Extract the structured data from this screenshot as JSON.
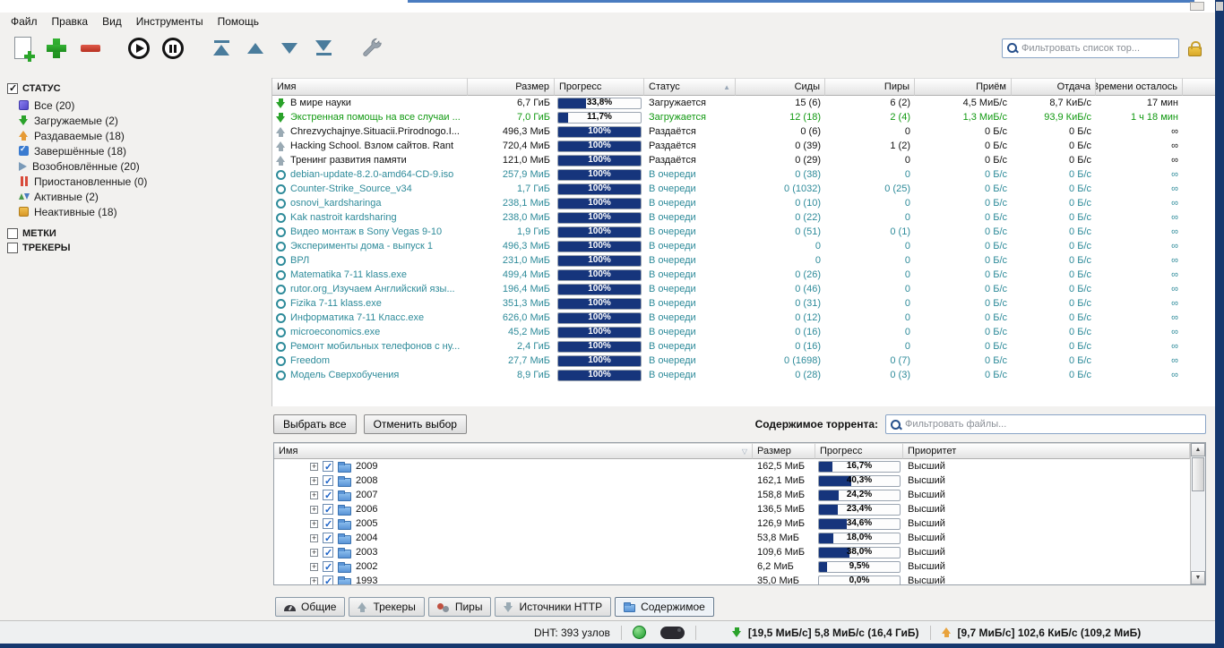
{
  "menu": {
    "items": [
      "Файл",
      "Правка",
      "Вид",
      "Инструменты",
      "Помощь"
    ]
  },
  "toolbar": {
    "filter_placeholder": "Фильтровать список тор...",
    "buttons": [
      "add-torrent",
      "add-link",
      "delete",
      "resume",
      "pause",
      "top-priority",
      "increase-priority",
      "decrease-priority",
      "bottom-priority",
      "options"
    ]
  },
  "icons": {
    "search-icon": "magnifier",
    "lock-icon": "gold padlock",
    "add-torrent-icon": "document with green plus",
    "add-link-icon": "green plus",
    "delete-icon": "red minus",
    "resume-icon": "circled play",
    "pause-icon": "circled pause",
    "top-priority-icon": "up triangle with top bar",
    "increase-priority-icon": "up triangle",
    "decrease-priority-icon": "down triangle",
    "bottom-priority-icon": "down triangle with bottom bar",
    "options-icon": "wrench",
    "globe-icon": "green globe",
    "speed-limit-icon": "dark turtle pill",
    "download-speed-icon": "green down arrow",
    "upload-speed-icon": "gold up arrow"
  },
  "colors": {
    "progress_fill": "#16357C",
    "downloading_text": "#119911",
    "queued_text": "#2E8B9A",
    "window_edge": "#16386E",
    "lock_gold": "#E2B736"
  },
  "sidebar": {
    "sections": [
      {
        "label": "СТАТУС",
        "checked": true
      },
      {
        "label": "МЕТКИ",
        "checked": false
      },
      {
        "label": "ТРЕКЕРЫ",
        "checked": false
      }
    ],
    "items": [
      {
        "key": "all",
        "label": "Все (20)"
      },
      {
        "key": "downloading",
        "label": "Загружаемые (2)"
      },
      {
        "key": "seeding",
        "label": "Раздаваемые (18)"
      },
      {
        "key": "completed",
        "label": "Завершённые (18)"
      },
      {
        "key": "resumed",
        "label": "Возобновлённые (20)"
      },
      {
        "key": "paused",
        "label": "Приостановленные (0)"
      },
      {
        "key": "active",
        "label": "Активные (2)"
      },
      {
        "key": "inactive",
        "label": "Неактивные (18)"
      }
    ]
  },
  "torrent_table": {
    "columns": [
      {
        "label": "Имя",
        "align": "left"
      },
      {
        "label": "Размер",
        "align": "right"
      },
      {
        "label": "Прогресс",
        "align": "left"
      },
      {
        "label": "Статус",
        "align": "left",
        "sort": "asc"
      },
      {
        "label": "Сиды",
        "align": "right"
      },
      {
        "label": "Пиры",
        "align": "right"
      },
      {
        "label": "Приём",
        "align": "right"
      },
      {
        "label": "Отдача",
        "align": "right"
      },
      {
        "label": "Времени осталось",
        "align": "right"
      }
    ],
    "rows": [
      {
        "name": "В мире науки",
        "icon": "downloading",
        "style": "",
        "size": "6,7 ГиБ",
        "progress": 33.8,
        "progress_label": "33,8%",
        "status": "Загружается",
        "seeds": "15 (6)",
        "peers": "6 (2)",
        "down": "4,5 МиБ/с",
        "up": "8,7 КиБ/с",
        "eta": "17 мин"
      },
      {
        "name": "Экстренная помощь на все случаи ...",
        "icon": "downloading",
        "style": "green",
        "size": "7,0 ГиБ",
        "progress": 11.7,
        "progress_label": "11,7%",
        "status": "Загружается",
        "seeds": "12 (18)",
        "peers": "2 (4)",
        "down": "1,3 МиБ/с",
        "up": "93,9 КиБ/с",
        "eta": "1 ч 18 мин"
      },
      {
        "name": "Chrezvychajnye.Situacii.Prirodnogo.I...",
        "icon": "seeding",
        "style": "",
        "size": "496,3 МиБ",
        "progress": 100,
        "progress_label": "100%",
        "status": "Раздаётся",
        "seeds": "0 (6)",
        "peers": "0",
        "down": "0 Б/с",
        "up": "0 Б/с",
        "eta": "∞"
      },
      {
        "name": "Hacking School. Взлом сайтов. Rant",
        "icon": "seeding",
        "style": "",
        "size": "720,4 МиБ",
        "progress": 100,
        "progress_label": "100%",
        "status": "Раздаётся",
        "seeds": "0 (39)",
        "peers": "1 (2)",
        "down": "0 Б/с",
        "up": "0 Б/с",
        "eta": "∞"
      },
      {
        "name": "Тренинг развития памяти",
        "icon": "seeding",
        "style": "",
        "size": "121,0 МиБ",
        "progress": 100,
        "progress_label": "100%",
        "status": "Раздаётся",
        "seeds": "0 (29)",
        "peers": "0",
        "down": "0 Б/с",
        "up": "0 Б/с",
        "eta": "∞"
      },
      {
        "name": "debian-update-8.2.0-amd64-CD-9.iso",
        "icon": "queued",
        "style": "teal",
        "size": "257,9 МиБ",
        "progress": 100,
        "progress_label": "100%",
        "status": "В очереди",
        "seeds": "0 (38)",
        "peers": "0",
        "down": "0 Б/с",
        "up": "0 Б/с",
        "eta": "∞"
      },
      {
        "name": "Counter-Strike_Source_v34",
        "icon": "queued",
        "style": "teal",
        "size": "1,7 ГиБ",
        "progress": 100,
        "progress_label": "100%",
        "status": "В очереди",
        "seeds": "0 (1032)",
        "peers": "0 (25)",
        "down": "0 Б/с",
        "up": "0 Б/с",
        "eta": "∞"
      },
      {
        "name": "osnovi_kardsharinga",
        "icon": "queued",
        "style": "teal",
        "size": "238,1 МиБ",
        "progress": 100,
        "progress_label": "100%",
        "status": "В очереди",
        "seeds": "0 (10)",
        "peers": "0",
        "down": "0 Б/с",
        "up": "0 Б/с",
        "eta": "∞"
      },
      {
        "name": "Kak nastroit kardsharing",
        "icon": "queued",
        "style": "teal",
        "size": "238,0 МиБ",
        "progress": 100,
        "progress_label": "100%",
        "status": "В очереди",
        "seeds": "0 (22)",
        "peers": "0",
        "down": "0 Б/с",
        "up": "0 Б/с",
        "eta": "∞"
      },
      {
        "name": "Видео монтаж в Sony Vegas 9-10",
        "icon": "queued",
        "style": "teal",
        "size": "1,9 ГиБ",
        "progress": 100,
        "progress_label": "100%",
        "status": "В очереди",
        "seeds": "0 (51)",
        "peers": "0 (1)",
        "down": "0 Б/с",
        "up": "0 Б/с",
        "eta": "∞"
      },
      {
        "name": "Эксперименты дома - выпуск 1",
        "icon": "queued",
        "style": "teal",
        "size": "496,3 МиБ",
        "progress": 100,
        "progress_label": "100%",
        "status": "В очереди",
        "seeds": "0",
        "peers": "0",
        "down": "0 Б/с",
        "up": "0 Б/с",
        "eta": "∞"
      },
      {
        "name": "ВРЛ",
        "icon": "queued",
        "style": "teal",
        "size": "231,0 МиБ",
        "progress": 100,
        "progress_label": "100%",
        "status": "В очереди",
        "seeds": "0",
        "peers": "0",
        "down": "0 Б/с",
        "up": "0 Б/с",
        "eta": "∞"
      },
      {
        "name": "Matematika 7-11 klass.exe",
        "icon": "queued",
        "style": "teal",
        "size": "499,4 МиБ",
        "progress": 100,
        "progress_label": "100%",
        "status": "В очереди",
        "seeds": "0 (26)",
        "peers": "0",
        "down": "0 Б/с",
        "up": "0 Б/с",
        "eta": "∞"
      },
      {
        "name": "rutor.org_Изучаем Английский язы...",
        "icon": "queued",
        "style": "teal",
        "size": "196,4 МиБ",
        "progress": 100,
        "progress_label": "100%",
        "status": "В очереди",
        "seeds": "0 (46)",
        "peers": "0",
        "down": "0 Б/с",
        "up": "0 Б/с",
        "eta": "∞"
      },
      {
        "name": "Fizika 7-11 klass.exe",
        "icon": "queued",
        "style": "teal",
        "size": "351,3 МиБ",
        "progress": 100,
        "progress_label": "100%",
        "status": "В очереди",
        "seeds": "0 (31)",
        "peers": "0",
        "down": "0 Б/с",
        "up": "0 Б/с",
        "eta": "∞"
      },
      {
        "name": "Информатика 7-11 Класс.exe",
        "icon": "queued",
        "style": "teal",
        "size": "626,0 МиБ",
        "progress": 100,
        "progress_label": "100%",
        "status": "В очереди",
        "seeds": "0 (12)",
        "peers": "0",
        "down": "0 Б/с",
        "up": "0 Б/с",
        "eta": "∞"
      },
      {
        "name": "microeconomics.exe",
        "icon": "queued",
        "style": "teal",
        "size": "45,2 МиБ",
        "progress": 100,
        "progress_label": "100%",
        "status": "В очереди",
        "seeds": "0 (16)",
        "peers": "0",
        "down": "0 Б/с",
        "up": "0 Б/с",
        "eta": "∞"
      },
      {
        "name": "Ремонт мобильных телефонов с ну...",
        "icon": "queued",
        "style": "teal",
        "size": "2,4 ГиБ",
        "progress": 100,
        "progress_label": "100%",
        "status": "В очереди",
        "seeds": "0 (16)",
        "peers": "0",
        "down": "0 Б/с",
        "up": "0 Б/с",
        "eta": "∞"
      },
      {
        "name": "Freedom",
        "icon": "queued",
        "style": "teal",
        "size": "27,7 МиБ",
        "progress": 100,
        "progress_label": "100%",
        "status": "В очереди",
        "seeds": "0 (1698)",
        "peers": "0 (7)",
        "down": "0 Б/с",
        "up": "0 Б/с",
        "eta": "∞"
      },
      {
        "name": "Модель Сверхобучения",
        "icon": "queued",
        "style": "teal",
        "size": "8,9 ГиБ",
        "progress": 100,
        "progress_label": "100%",
        "status": "В очереди",
        "seeds": "0 (28)",
        "peers": "0 (3)",
        "down": "0 Б/с",
        "up": "0 Б/с",
        "eta": "∞"
      }
    ]
  },
  "content_panel": {
    "select_all": "Выбрать все",
    "deselect": "Отменить выбор",
    "label": "Содержимое торрента:",
    "filter_placeholder": "Фильтровать файлы..."
  },
  "files_table": {
    "columns": [
      {
        "label": "Имя",
        "align": "left",
        "sort": "desc"
      },
      {
        "label": "Размер",
        "align": "left"
      },
      {
        "label": "Прогресс",
        "align": "left"
      },
      {
        "label": "Приоритет",
        "align": "left"
      }
    ],
    "rows": [
      {
        "name": "2009",
        "checked": true,
        "size": "162,5 МиБ",
        "progress": 16.7,
        "progress_label": "16,7%",
        "priority": "Высший"
      },
      {
        "name": "2008",
        "checked": true,
        "size": "162,1 МиБ",
        "progress": 40.3,
        "progress_label": "40,3%",
        "priority": "Высший"
      },
      {
        "name": "2007",
        "checked": true,
        "size": "158,8 МиБ",
        "progress": 24.2,
        "progress_label": "24,2%",
        "priority": "Высший"
      },
      {
        "name": "2006",
        "checked": true,
        "size": "136,5 МиБ",
        "progress": 23.4,
        "progress_label": "23,4%",
        "priority": "Высший"
      },
      {
        "name": "2005",
        "checked": true,
        "size": "126,9 МиБ",
        "progress": 34.6,
        "progress_label": "34,6%",
        "priority": "Высший"
      },
      {
        "name": "2004",
        "checked": true,
        "size": "53,8 МиБ",
        "progress": 18.0,
        "progress_label": "18,0%",
        "priority": "Высший"
      },
      {
        "name": "2003",
        "checked": true,
        "size": "109,6 МиБ",
        "progress": 38.0,
        "progress_label": "38,0%",
        "priority": "Высший"
      },
      {
        "name": "2002",
        "checked": true,
        "size": "6,2 МиБ",
        "progress": 9.5,
        "progress_label": "9,5%",
        "priority": "Высший"
      },
      {
        "name": "1993",
        "checked": true,
        "size": "35,0 МиБ",
        "progress": 0.0,
        "progress_label": "0,0%",
        "priority": "Высший"
      }
    ]
  },
  "tabs": [
    {
      "key": "general",
      "label": "Общие",
      "active": false
    },
    {
      "key": "trackers",
      "label": "Трекеры",
      "active": false
    },
    {
      "key": "peers",
      "label": "Пиры",
      "active": false
    },
    {
      "key": "http",
      "label": "Источники HTTP",
      "active": false
    },
    {
      "key": "content",
      "label": "Содержимое",
      "active": true
    }
  ],
  "statusbar": {
    "dht": "DHT: 393 узлов",
    "download": "[19,5 МиБ/с] 5,8 МиБ/с (16,4 ГиБ)",
    "upload": "[9,7 МиБ/с] 102,6 КиБ/с (109,2 МиБ)"
  }
}
